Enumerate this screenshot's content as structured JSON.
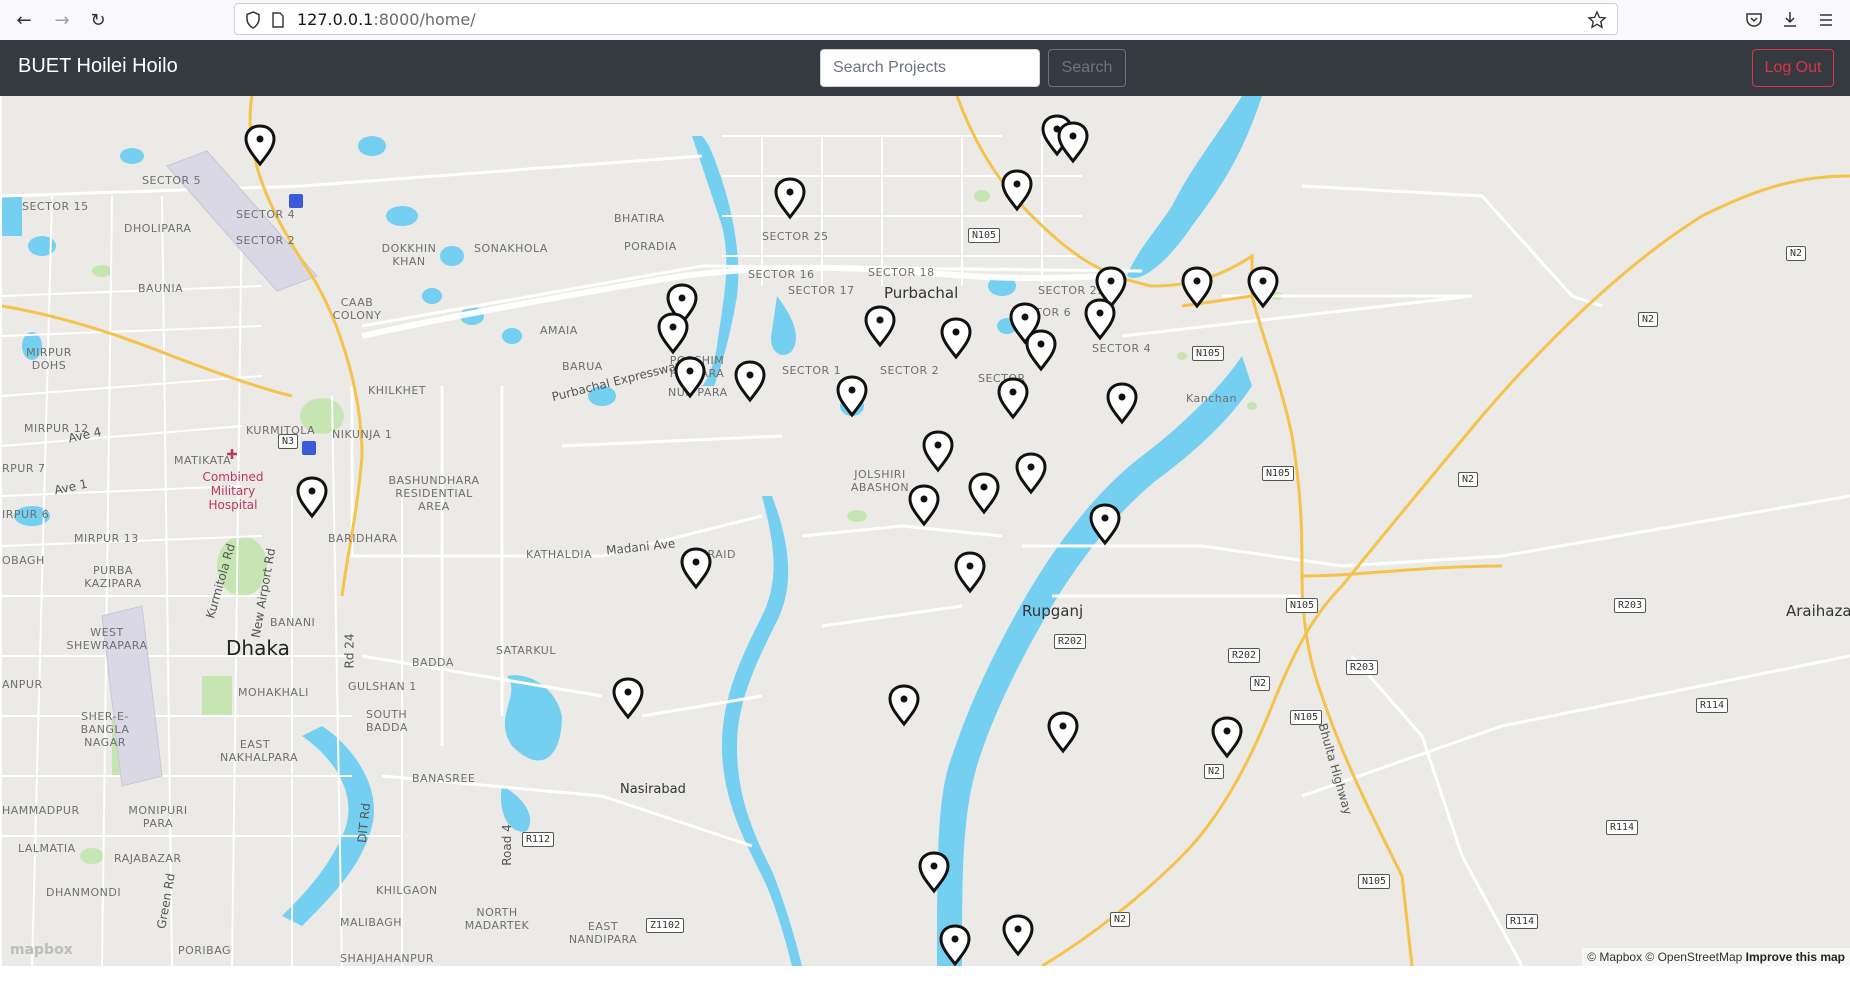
{
  "browser": {
    "url_host": "127.0.0.1",
    "url_path": ":8000/home/",
    "back_icon": "arrow-left-icon",
    "forward_icon": "arrow-right-icon",
    "reload_icon": "reload-icon"
  },
  "navbar": {
    "brand": "BUET Hoilei Hoilo",
    "search_placeholder": "Search Projects",
    "search_label": "Search",
    "logout_label": "Log Out"
  },
  "map": {
    "labels": {
      "dhaka": "Dhaka",
      "purbachal": "Purbachal",
      "rupganj": "Rupganj",
      "nasirabad": "Nasirabad",
      "araihazar": "Araihazar",
      "kanchan": "Kanchan",
      "sector5": "SECTOR 5",
      "sector4": "SECTOR 4",
      "sector2": "SECTOR 2",
      "dholipara": "DHOLIPARA",
      "baunia": "BAUNIA",
      "dokkhin_khan": "DOKKHIN KHAN",
      "sonakhola": "SONAKHOLA",
      "bhatira": "BHATIRA",
      "poradia": "PORADIA",
      "amaia": "AMAIA",
      "barua": "BARUA",
      "khilkhet": "KHILKHET",
      "kurmitola": "KURMITOLA",
      "nikunja": "NIKUNJA 1",
      "mirpur12": "MIRPUR 12",
      "mirpur13": "MIRPUR 13",
      "matikata": "MATIKATA",
      "bashundhara": "BASHUNDHARA RESIDENTIAL AREA",
      "baridhara": "BARIDHARA",
      "banani": "BANANI",
      "gulshan": "GULSHAN 1",
      "badda": "BADDA",
      "satarkul": "SATARKUL",
      "south_badda": "SOUTH BADDA",
      "banasree": "BANASREE",
      "khilgaon": "KHILGAON",
      "malibagh": "MALIBAGH",
      "north_madartek": "NORTH MADARTEK",
      "east_nandipara": "EAST NANDIPARA",
      "poschim_hajipara": "POSCHIM HAJIPARA",
      "nur_para": "NUR PARA",
      "jolshiri": "JOLSHIRI ABASHON",
      "kathaldia": "KATHALDIA",
      "beraid": "BERAID",
      "purba_kazipara": "PURBA KAZIPARA",
      "west_shewrapara": "WEST SHEWRAPARA",
      "mohakhali": "MOHAKHALI",
      "east_nakhalpara": "EAST NAKHALPARA",
      "sher_e_bangla": "SHER-E-BANGLA NAGAR",
      "monipuri": "MONIPURI PARA",
      "rajabazar": "RAJABAZAR",
      "lalmatia": "LALMATIA",
      "dhanmondi": "DHANMONDI",
      "caab": "CAAB COLONY",
      "sector25": "SECTOR 25",
      "sector16": "SECTOR 16",
      "sector17": "SECTOR 17",
      "sector18": "SECTOR 18",
      "sector21": "SECTOR 21",
      "sector6": "SECTOR 6",
      "sector4b": "SECTOR 4",
      "sector_2b": "SECTOR 2",
      "sector_1": "SECTOR 1",
      "sector_x": "SECTOR",
      "mirpur_dohs": "MIRPUR DOHS",
      "hospital": "Combined Military Hospital",
      "purbachal_expressway": "Purbachal Expressway",
      "madani_ave": "Madani Ave",
      "ave4": "Ave 4",
      "ave1": "Ave 1",
      "kurmitola_rd": "Kurmitola Rd",
      "new_airport_rd": "New Airport Rd",
      "rd24": "Rd 24",
      "dit_rd": "DIT Rd",
      "road4": "Road 4",
      "green_rd": "Green Rd",
      "bhulta_highway": "Bhulta Highway",
      "poribag": "PORIBAG",
      "shahjahanpur": "SHAHJAHANPUR",
      "ammadpur": "HAMMADPUR",
      "obagh": "OBAGH",
      "irpur6": "IRPUR 6",
      "rpur7": "RPUR 7",
      "anpur": "ANPUR",
      "sector15": "SECTOR 15"
    },
    "shields": {
      "n105a": "N105",
      "n105b": "N105",
      "n105c": "N105",
      "n105d": "N105",
      "n105e": "N105",
      "n105f": "N105",
      "n2a": "N2",
      "n2b": "N2",
      "n2c": "N2",
      "n2d": "N2",
      "n2e": "N2",
      "n2f": "N2",
      "n3": "N3",
      "r202a": "R202",
      "r202b": "R202",
      "r203a": "R203",
      "r203b": "R203",
      "r114a": "R114",
      "r114b": "R114",
      "r114c": "R114",
      "r112": "R112",
      "z1102": "Z1102"
    },
    "markers": [
      {
        "lon": 0.1397,
        "lat": 0.0306
      },
      {
        "lon": 0.4262,
        "lat": 0.0917
      },
      {
        "lon": 0.5707,
        "lat": 0.0194
      },
      {
        "lon": 0.5795,
        "lat": 0.0278
      },
      {
        "lon": 0.549,
        "lat": 0.0833
      },
      {
        "lon": 0.6,
        "lat": 0.1944
      },
      {
        "lon": 0.6468,
        "lat": 0.1944
      },
      {
        "lon": 0.6826,
        "lat": 0.1944
      },
      {
        "lon": 0.3681,
        "lat": 0.2139
      },
      {
        "lon": 0.363,
        "lat": 0.2472
      },
      {
        "lon": 0.475,
        "lat": 0.2389
      },
      {
        "lon": 0.516,
        "lat": 0.2528
      },
      {
        "lon": 0.5534,
        "lat": 0.2361
      },
      {
        "lon": 0.5942,
        "lat": 0.2306
      },
      {
        "lon": 0.5622,
        "lat": 0.2667
      },
      {
        "lon": 0.3723,
        "lat": 0.2972
      },
      {
        "lon": 0.405,
        "lat": 0.3028
      },
      {
        "lon": 0.4602,
        "lat": 0.3194
      },
      {
        "lon": 0.5471,
        "lat": 0.3222
      },
      {
        "lon": 0.606,
        "lat": 0.3278
      },
      {
        "lon": 0.5065,
        "lat": 0.3833
      },
      {
        "lon": 0.5568,
        "lat": 0.4083
      },
      {
        "lon": 0.1679,
        "lat": 0.4361
      },
      {
        "lon": 0.4987,
        "lat": 0.4444
      },
      {
        "lon": 0.5315,
        "lat": 0.4306
      },
      {
        "lon": 0.5966,
        "lat": 0.4667
      },
      {
        "lon": 0.3757,
        "lat": 0.5167
      },
      {
        "lon": 0.524,
        "lat": 0.5222
      },
      {
        "lon": 0.3387,
        "lat": 0.6667
      },
      {
        "lon": 0.488,
        "lat": 0.675
      },
      {
        "lon": 0.574,
        "lat": 0.7056
      },
      {
        "lon": 0.663,
        "lat": 0.7111
      },
      {
        "lon": 0.5045,
        "lat": 0.8667
      },
      {
        "lon": 0.55,
        "lat": 0.9389
      },
      {
        "lon": 0.5155,
        "lat": 0.95
      }
    ],
    "mapbox_logo": "mapbox",
    "attribution": "© Mapbox © OpenStreetMap",
    "improve": "Improve this map",
    "colors": {
      "land": "#ebeae6",
      "water": "#75cff0",
      "park": "#c5e6b3",
      "highway": "#f5c34b",
      "road": "#ffffff",
      "marker": "#111111"
    }
  }
}
